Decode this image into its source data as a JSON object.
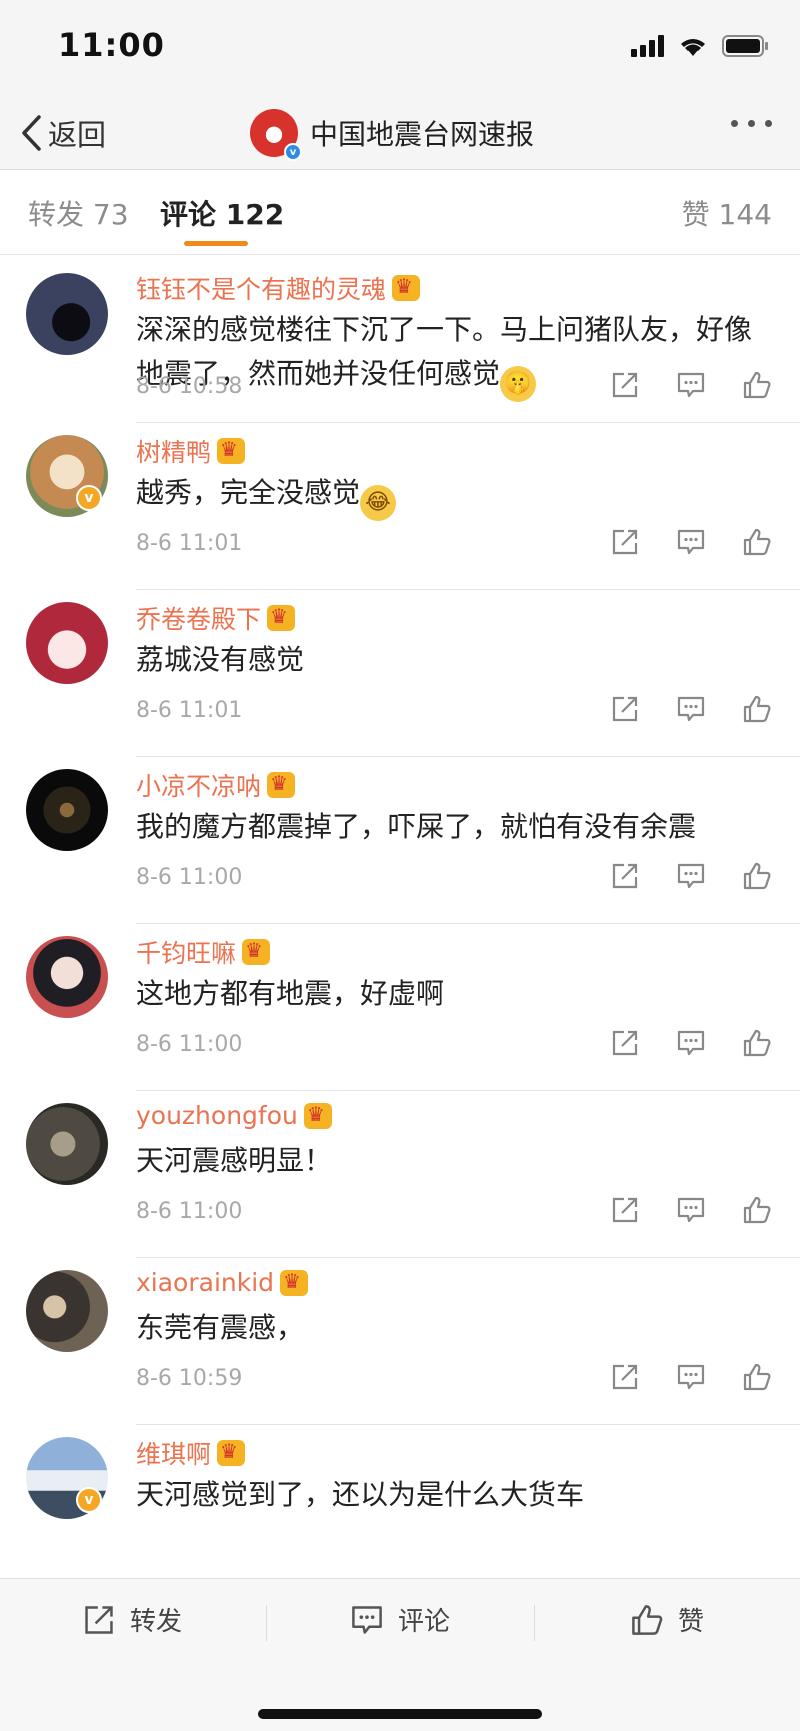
{
  "status_bar": {
    "time": "11:00"
  },
  "nav": {
    "back_label": "返回",
    "title": "中国地震台网速报",
    "verified": "v"
  },
  "tabs": {
    "repost": "转发 73",
    "comment": "评论 122",
    "like": "赞 144"
  },
  "comments": [
    {
      "username": "钰钰不是个有趣的灵魂",
      "text": "深深的感觉楼往下沉了一下。马上问猪队友，好像地震了，然而她并没任何感觉",
      "emoji": "🤫",
      "time": "8-6 10:58",
      "avatar_color": "#2e3448"
    },
    {
      "username": "树精鸭",
      "text": "越秀，完全没感觉",
      "emoji": "😂",
      "time": "8-6 11:01",
      "avatar_color": "#c89a6a"
    },
    {
      "username": "乔卷卷殿下",
      "text": "荔城没有感觉",
      "emoji": "",
      "time": "8-6 11:01",
      "avatar_color": "#b23a4a"
    },
    {
      "username": "小凉不凉呐",
      "text": "我的魔方都震掉了，吓屎了，就怕有没有余震",
      "emoji": "",
      "time": "8-6 11:00",
      "avatar_color": "#1a1a1a"
    },
    {
      "username": "千钧旺嘛",
      "text": "这地方都有地震，好虚啊",
      "emoji": "",
      "time": "8-6 11:00",
      "avatar_color": "#d9c3b8"
    },
    {
      "username": "youzhongfou",
      "text": "天河震感明显！",
      "emoji": "",
      "time": "8-6 11:00",
      "avatar_color": "#5c5a52"
    },
    {
      "username": "xiaorainkid",
      "text": "东莞有震感，",
      "emoji": "",
      "time": "8-6 10:59",
      "avatar_color": "#4a4038"
    },
    {
      "username": "维琪啊",
      "text": "天河感觉到了，还以为是什么大货车",
      "emoji": "",
      "time": "",
      "avatar_color": "#6f88a8"
    }
  ],
  "bottom_bar": {
    "repost": "转发",
    "comment": "评论",
    "like": "赞"
  },
  "colors": {
    "accent": "#f08a1a",
    "username": "#eb7350",
    "timestamp": "#a8a8a8"
  }
}
